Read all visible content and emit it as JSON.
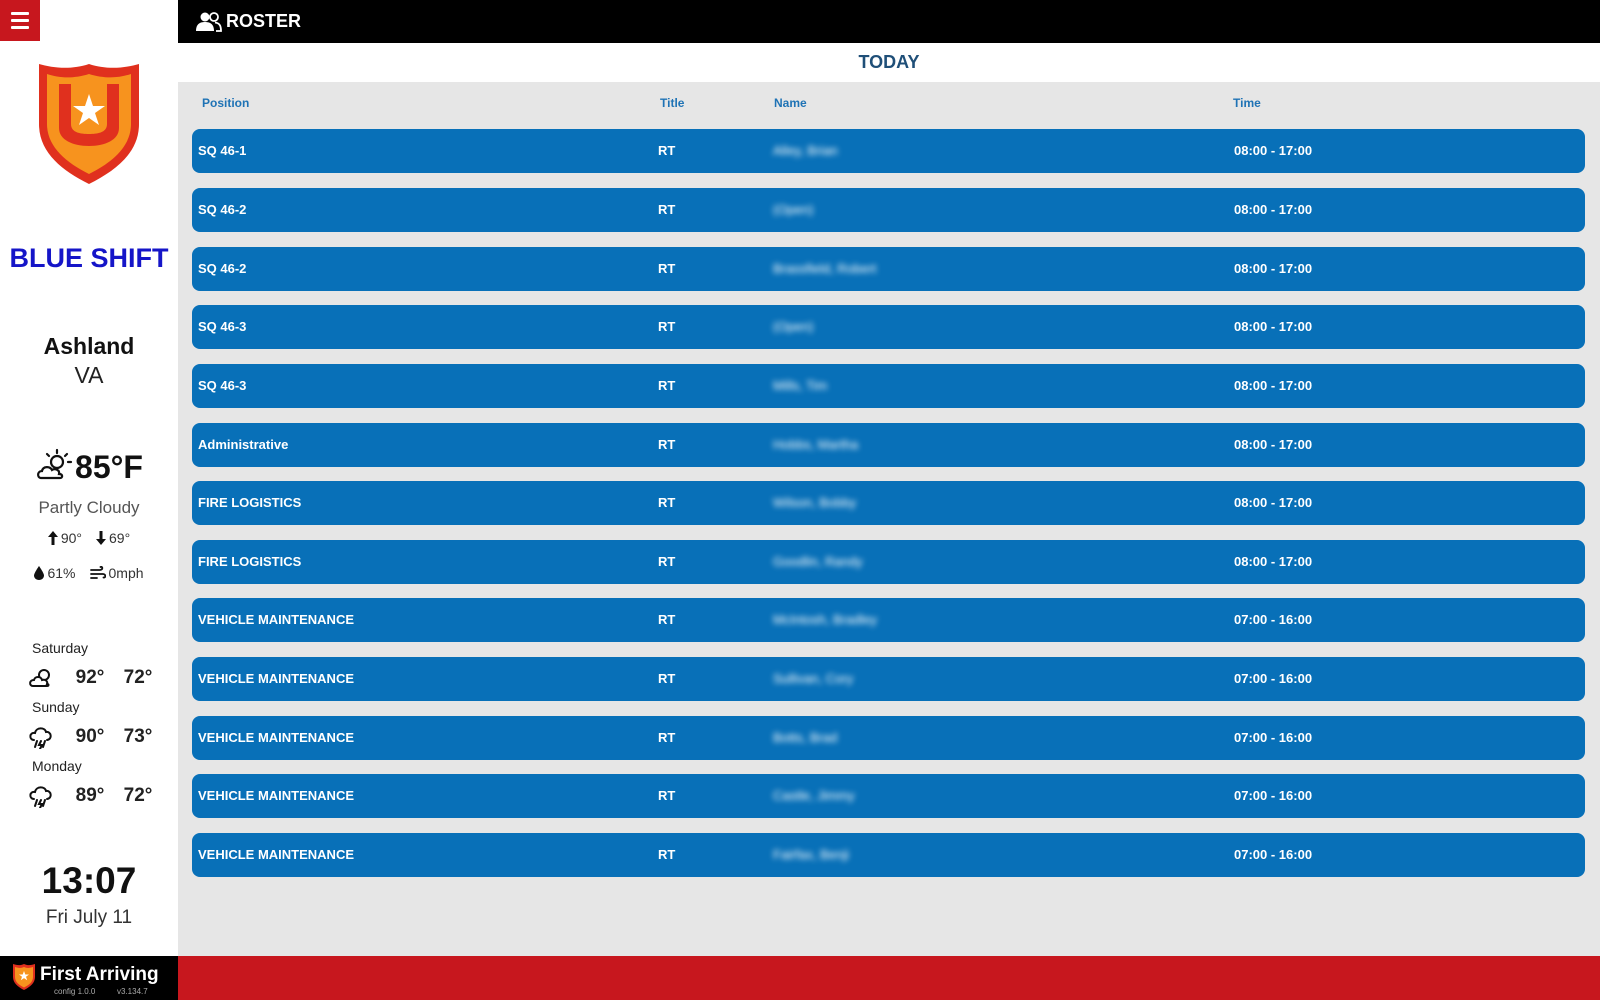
{
  "sidebar": {
    "shift_name": "BLUE SHIFT",
    "city": "Ashland",
    "state": "VA",
    "weather": {
      "temperature": "85°F",
      "condition": "Partly Cloudy",
      "high": "90°",
      "low": "69°",
      "humidity": "61%",
      "wind": "0mph"
    },
    "forecast": [
      {
        "day": "Saturday",
        "icon": "partly-cloudy-icon",
        "high": "92°",
        "low": "72°"
      },
      {
        "day": "Sunday",
        "icon": "thunderstorm-icon",
        "high": "90°",
        "low": "73°"
      },
      {
        "day": "Monday",
        "icon": "thunderstorm-icon",
        "high": "89°",
        "low": "72°"
      }
    ],
    "clock": "13:07",
    "date": "Fri July 11",
    "brand": {
      "name": "First Arriving",
      "config_version": "config 1.0.0",
      "app_version": "v3.134.7"
    }
  },
  "header": {
    "title": "ROSTER",
    "icon": "users-icon"
  },
  "roster": {
    "day_label": "TODAY",
    "columns": {
      "position": "Position",
      "title": "Title",
      "name": "Name",
      "time": "Time"
    },
    "rows": [
      {
        "position": "SQ 46-1",
        "title": "RT",
        "name": "Alley, Brian",
        "time": "08:00 - 17:00"
      },
      {
        "position": "SQ 46-2",
        "title": "RT",
        "name": "(Open)",
        "time": "08:00 - 17:00"
      },
      {
        "position": "SQ 46-2",
        "title": "RT",
        "name": "Brassfield, Robert",
        "time": "08:00 - 17:00"
      },
      {
        "position": "SQ 46-3",
        "title": "RT",
        "name": "(Open)",
        "time": "08:00 - 17:00"
      },
      {
        "position": "SQ 46-3",
        "title": "RT",
        "name": "Mills, Tim",
        "time": "08:00 - 17:00"
      },
      {
        "position": "Administrative",
        "title": "RT",
        "name": "Hobbs, Martha",
        "time": "08:00 - 17:00"
      },
      {
        "position": "FIRE LOGISTICS",
        "title": "RT",
        "name": "Wilson, Bobby",
        "time": "08:00 - 17:00"
      },
      {
        "position": "FIRE LOGISTICS",
        "title": "RT",
        "name": "Goodlin, Randy",
        "time": "08:00 - 17:00"
      },
      {
        "position": "VEHICLE MAINTENANCE",
        "title": "RT",
        "name": "McIntosh, Bradley",
        "time": "07:00 - 16:00"
      },
      {
        "position": "VEHICLE MAINTENANCE",
        "title": "RT",
        "name": "Sullivan, Cory",
        "time": "07:00 - 16:00"
      },
      {
        "position": "VEHICLE MAINTENANCE",
        "title": "RT",
        "name": "Botts, Brad",
        "time": "07:00 - 16:00"
      },
      {
        "position": "VEHICLE MAINTENANCE",
        "title": "RT",
        "name": "Castle, Jimmy",
        "time": "07:00 - 16:00"
      },
      {
        "position": "VEHICLE MAINTENANCE",
        "title": "RT",
        "name": "Fairfax, Benji",
        "time": "07:00 - 16:00"
      }
    ]
  },
  "colors": {
    "accent_red": "#c7171e",
    "row_blue": "#0870b8",
    "shift_blue": "#1515c8",
    "header_text": "#1f4f78"
  }
}
